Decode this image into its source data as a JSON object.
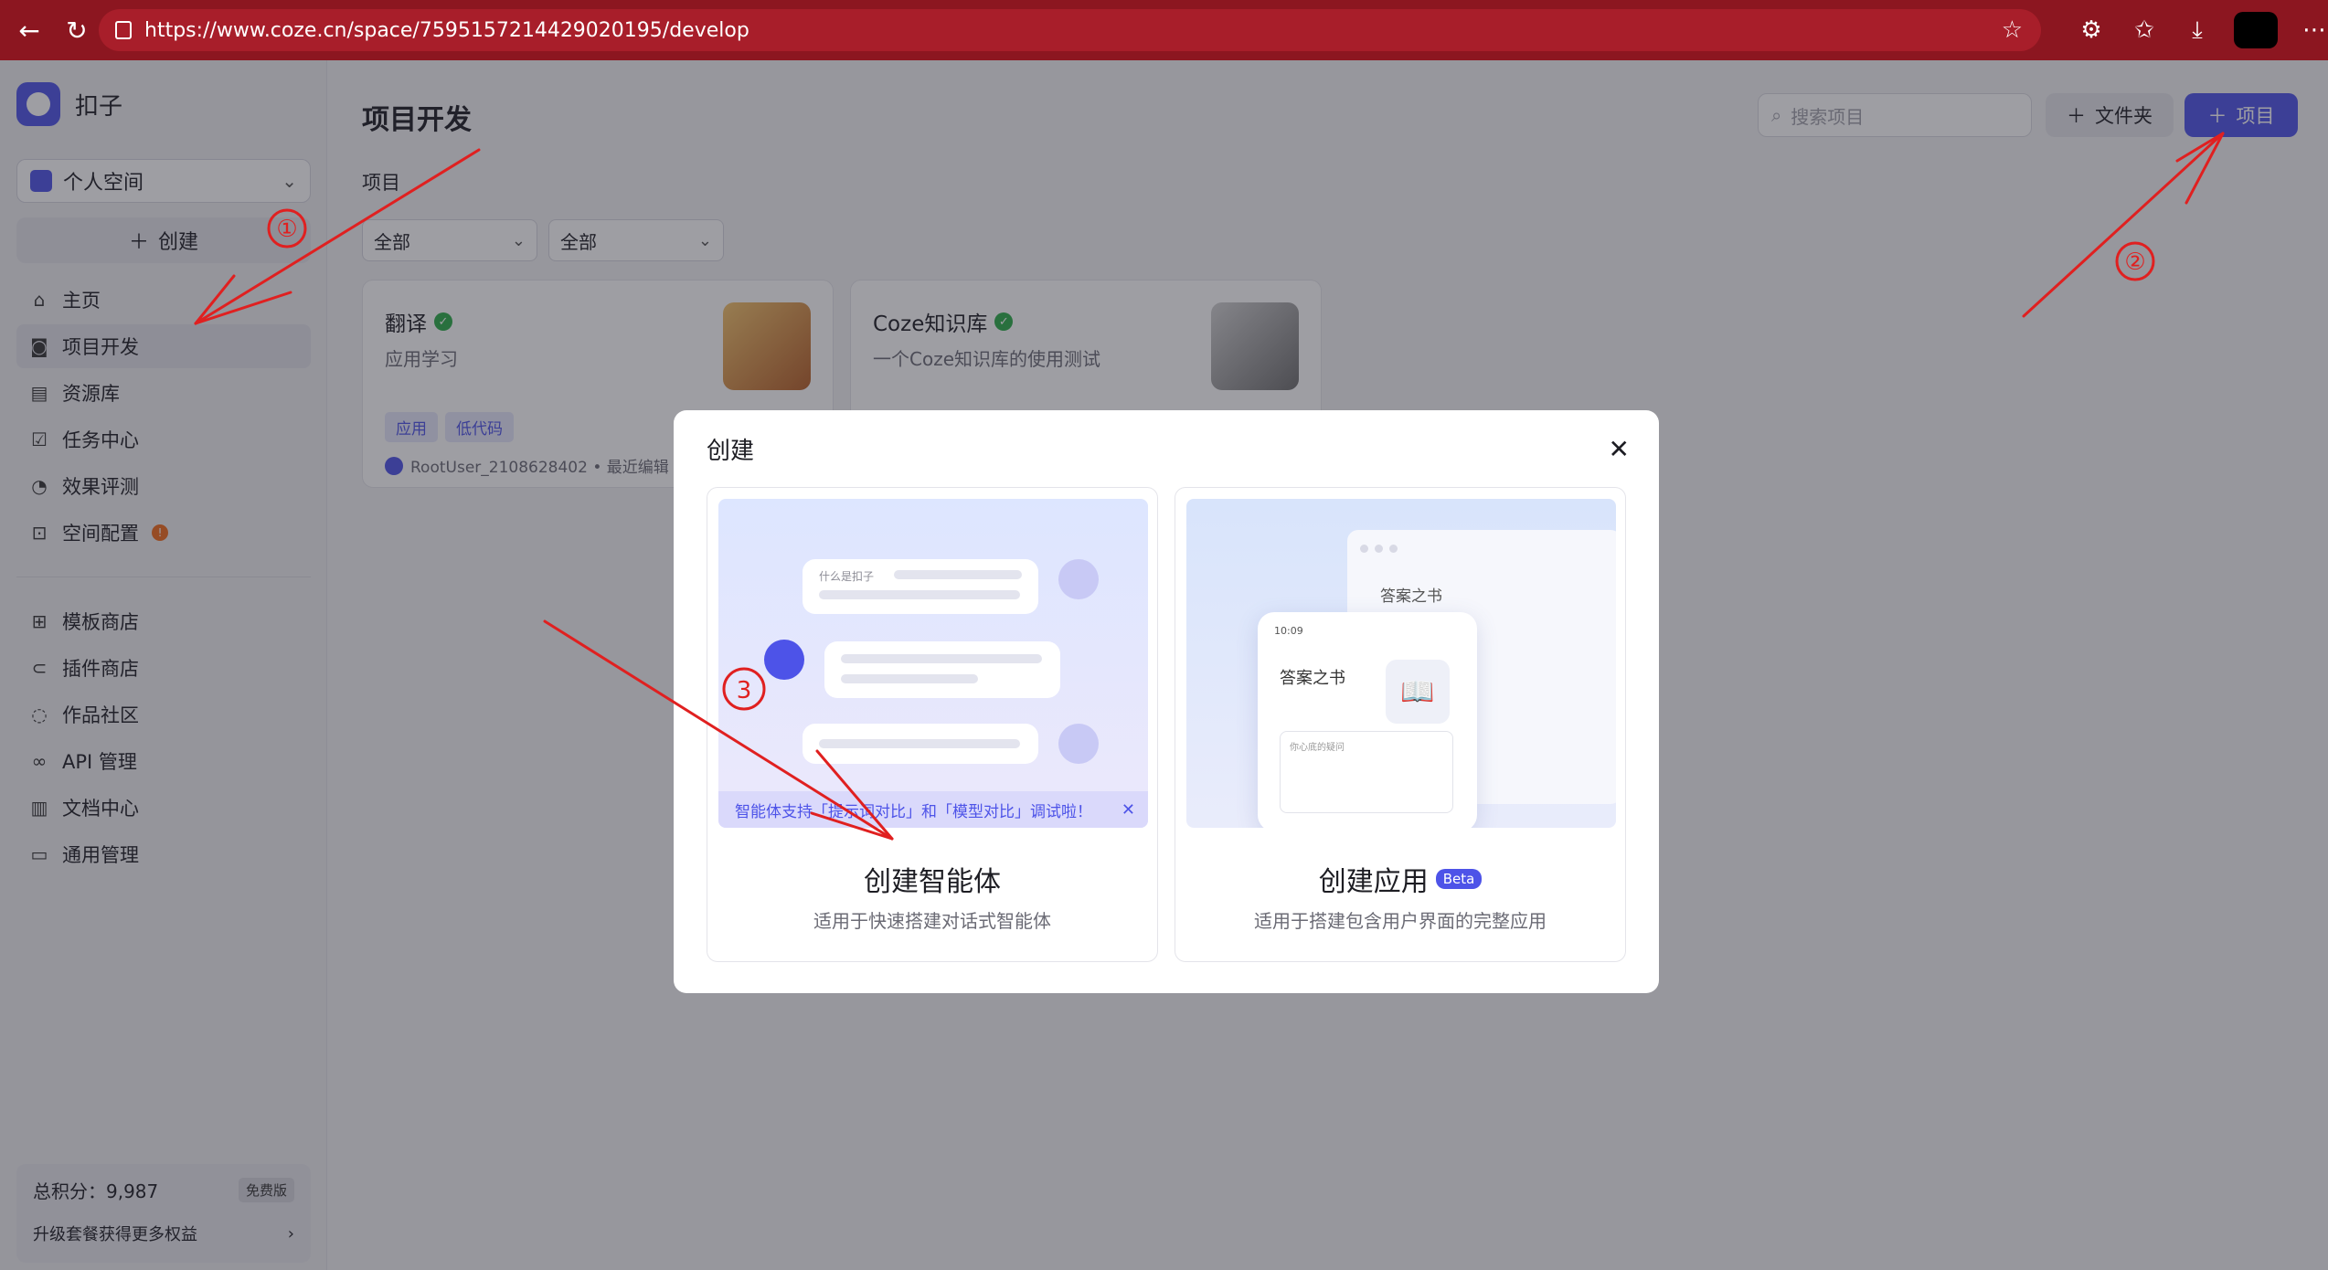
{
  "browser": {
    "url": "https://www.coze.cn/space/7595157214429020195/develop"
  },
  "sidebar": {
    "brand": "扣子",
    "space_selector": "个人空间",
    "create_label": "创建",
    "nav_primary": [
      {
        "label": "主页",
        "icon": "home-icon"
      },
      {
        "label": "项目开发",
        "icon": "robot-icon",
        "active": true
      },
      {
        "label": "资源库",
        "icon": "library-icon"
      },
      {
        "label": "任务中心",
        "icon": "task-icon"
      },
      {
        "label": "效果评测",
        "icon": "gauge-icon"
      },
      {
        "label": "空间配置",
        "icon": "settings-icon",
        "badge": "!"
      }
    ],
    "nav_secondary": [
      {
        "label": "模板商店",
        "icon": "template-icon"
      },
      {
        "label": "插件商店",
        "icon": "plugin-icon"
      },
      {
        "label": "作品社区",
        "icon": "community-icon"
      },
      {
        "label": "API 管理",
        "icon": "api-icon"
      },
      {
        "label": "文档中心",
        "icon": "doc-icon"
      },
      {
        "label": "通用管理",
        "icon": "manage-icon"
      }
    ],
    "points_label": "总积分：9,987",
    "plan_badge": "免费版",
    "upgrade_text": "升级套餐获得更多权益"
  },
  "main": {
    "title": "项目开发",
    "search_placeholder": "搜索项目",
    "folder_button": "文件夹",
    "project_button": "项目",
    "section_label": "项目",
    "filters": [
      "全部",
      "全部"
    ],
    "cards": [
      {
        "name": "翻译",
        "desc": "应用学习",
        "tags": [
          "应用",
          "低代码"
        ],
        "meta": "RootUser_2108628402 • 最近编辑"
      },
      {
        "name": "Coze知识库",
        "desc": "一个Coze知识库的使用测试",
        "tags": [],
        "meta": ""
      }
    ]
  },
  "modal": {
    "title": "创建",
    "option_agent": {
      "title": "创建智能体",
      "desc": "适用于快速搭建对话式智能体",
      "chat_hint": "什么是扣子",
      "notice": "智能体支持「提示词对比」和「模型对比」调试啦！"
    },
    "option_app": {
      "title": "创建应用",
      "badge": "Beta",
      "desc": "适用于搭建包含用户界面的完整应用",
      "window_title": "答案之书",
      "phone_title": "答案之书",
      "phone_time": "10:09",
      "phone_placeholder": "你心底的疑问"
    }
  },
  "annotations": [
    "①",
    "②",
    "3"
  ],
  "colors": {
    "accent": "#4d53e8",
    "browser_bar": "#8c1620",
    "annotation": "#e02020"
  }
}
